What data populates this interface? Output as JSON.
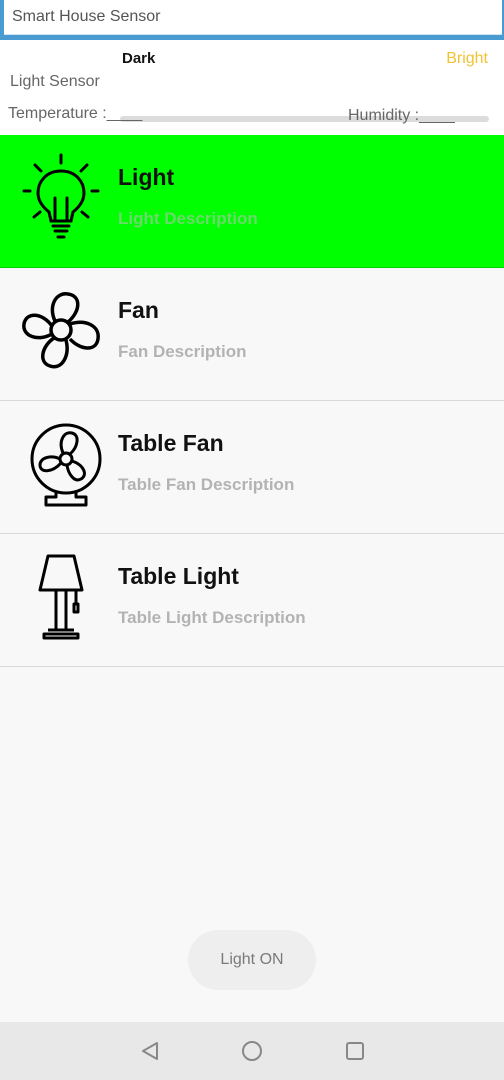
{
  "header": {
    "title": "Smart House Sensor"
  },
  "sensor": {
    "dark_label": "Dark",
    "bright_label": "Bright",
    "light_sensor_label": "Light Sensor",
    "temperature_label": "Temperature :____",
    "humidity_label": "Humidity :____"
  },
  "devices": [
    {
      "name": "Light",
      "description": "Light Description",
      "icon": "light-bulb-icon",
      "active": true
    },
    {
      "name": "Fan",
      "description": "Fan Description",
      "icon": "fan-icon",
      "active": false
    },
    {
      "name": "Table Fan",
      "description": "Table Fan Description",
      "icon": "table-fan-icon",
      "active": false
    },
    {
      "name": "Table Light",
      "description": "Table Light Description",
      "icon": "table-lamp-icon",
      "active": false
    }
  ],
  "button": {
    "label": "Light ON"
  },
  "colors": {
    "active": "#00ff00",
    "bright": "#f1c232",
    "titlebar": "#4a9bd1"
  }
}
